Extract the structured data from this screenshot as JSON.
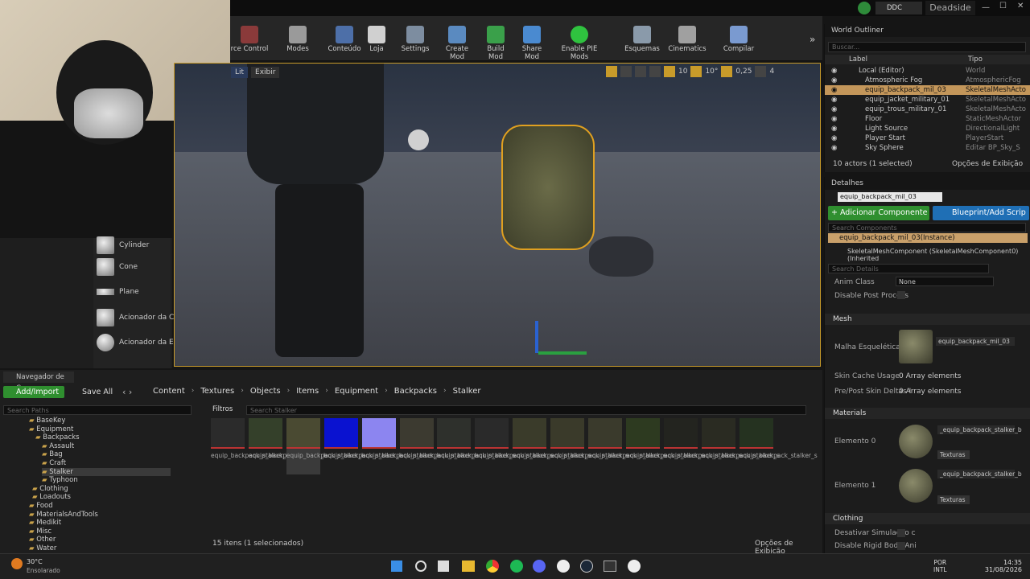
{
  "topbar": {
    "ddc": "DDC",
    "project": "Deadside"
  },
  "toolbar": {
    "items": [
      "rce Control",
      "Modes",
      "Conteúdo",
      "Loja",
      "Settings",
      "Create Mod",
      "Build Mod",
      "Share Mod",
      "Enable PIE Mods",
      "Esquemas",
      "Cinematics",
      "Compilar"
    ]
  },
  "viewport": {
    "lit": "Lit",
    "show": "Exibir",
    "grid": "10",
    "angle": "10°",
    "scale": "0,25",
    "cams": "4"
  },
  "shapes": [
    "Cylinder",
    "Cone",
    "Plane",
    "Acionador da C",
    "Acionador da E"
  ],
  "outliner": {
    "title": "World Outliner",
    "search": "Buscar...",
    "col_label": "Label",
    "col_type": "Tipo",
    "rows": [
      {
        "label": "Local (Editor)",
        "type": "World"
      },
      {
        "label": "Atmospheric Fog",
        "type": "AtmosphericFog"
      },
      {
        "label": "equip_backpack_mil_03",
        "type": "SkeletalMeshActo"
      },
      {
        "label": "equip_jacket_military_01",
        "type": "SkeletalMeshActo"
      },
      {
        "label": "equip_trous_military_01",
        "type": "SkeletalMeshActo"
      },
      {
        "label": "Floor",
        "type": "StaticMeshActor"
      },
      {
        "label": "Light Source",
        "type": "DirectionalLight"
      },
      {
        "label": "Player Start",
        "type": "PlayerStart"
      },
      {
        "label": "Sky Sphere",
        "type": "Editar BP_Sky_S"
      }
    ],
    "count": "10 actors (1 selected)",
    "view_options": "Opções de Exibição"
  },
  "details": {
    "title": "Detalhes",
    "name": "equip_backpack_mil_03",
    "add_component": "+ Adicionar Componente",
    "blueprint": "Blueprint/Add Scrip",
    "search_components": "Search Components",
    "instance": "equip_backpack_mil_03(Instance)",
    "component": "SkeletalMeshComponent (SkeletalMeshComponent0) (Inherited",
    "search_details": "Search Details",
    "anim_class": "Anim Class",
    "anim_value": "None",
    "disable_post": "Disable Post Process",
    "mesh_section": "Mesh",
    "mesh_label": "Malha Esquelética",
    "mesh_value": "equip_backpack_mil_03",
    "skin_cache": "Skin Cache Usage",
    "skin_cache_val": "0 Array elements",
    "prepost": "Pre/Post Skin Deltas I",
    "prepost_val": "0 Array elements",
    "materials_section": "Materials",
    "elem0": "Elemento 0",
    "elem1": "Elemento 1",
    "mat0": "_equip_backpack_stalker_b",
    "mat1": "_equip_backpack_stalker_b",
    "texturas": "Texturas",
    "clothing_section": "Clothing",
    "desativar": "Desativar Simulação c",
    "disable_rigid": "Disable Rigid Body Ani"
  },
  "browser": {
    "tab": "Navegador de Con",
    "add_import": "Add/Import",
    "save_all": "Save All",
    "path": [
      "Content",
      "Textures",
      "Objects",
      "Items",
      "Equipment",
      "Backpacks",
      "Stalker"
    ],
    "search_paths": "Search Paths",
    "filters": "Filtros",
    "search_assets": "Search Stalker",
    "tree": [
      "BaseKey",
      "Equipment",
      "Backpacks",
      "Assault",
      "Bag",
      "Craft",
      "Stalker",
      "Typhoon",
      "Clothing",
      "Loadouts",
      "Food",
      "MaterialsAndTools",
      "Medikit",
      "Misc",
      "Other",
      "Water"
    ],
    "assets": [
      "equip_backpack_stalker_b",
      "equip_backpack_stalker_b",
      "equip_backpack_stalker_b",
      "equip_backpack_stalker_b",
      "equip_backpack_stalker_b",
      "equip_backpack_stalker_b",
      "equip_backpack_stalker_s",
      "equip_backpack_stalker_s",
      "equip_backpack_stalker_s",
      "equip_backpack_stalker_s",
      "equip_backpack_stalker_s",
      "equip_backpack_stalker_s",
      "equip_backpack_stalker_s",
      "equip_backpack_stalker_s",
      "equip_backpack_stalker_s"
    ],
    "count": "15 itens (1 selecionados)",
    "view_options": "Opções de Exibição"
  },
  "taskbar": {
    "temp": "30°C",
    "weather": "Ensolarado",
    "lang1": "POR",
    "lang2": "INTL",
    "time": "14:35",
    "date": "31/08/2026"
  }
}
